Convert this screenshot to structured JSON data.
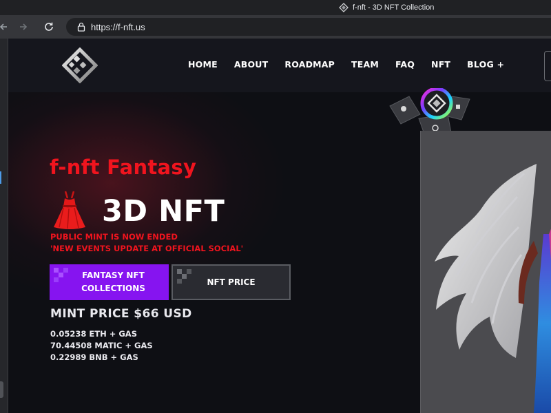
{
  "browser": {
    "tab_title": "f-nft - 3D NFT Collection",
    "url": "https://f-nft.us"
  },
  "site": {
    "nav": [
      {
        "label": "HOME"
      },
      {
        "label": "ABOUT"
      },
      {
        "label": "ROADMAP"
      },
      {
        "label": "TEAM"
      },
      {
        "label": "FAQ"
      },
      {
        "label": "NFT"
      },
      {
        "label": "BLOG +"
      }
    ]
  },
  "hero": {
    "title": "f-nft Fantasy",
    "subtitle": "3D NFT",
    "notices": [
      "PUBLIC MINT IS NOW ENDED",
      "'NEW EVENTS UPDATE AT OFFICIAL SOCIAL'"
    ],
    "buttons": {
      "collections_line1": "FANTASY NFT",
      "collections_line2": "COLLECTIONS",
      "price": "NFT PRICE"
    },
    "mint_price": "MINT PRICE $66 USD",
    "prices": [
      "0.05238 ETH + GAS",
      "70.44508 MATIC + GAS",
      "0.22989 BNB + GAS"
    ]
  },
  "icons": {
    "lock": "lock-icon",
    "back": "back-arrow-icon",
    "forward": "forward-arrow-icon",
    "reload": "reload-icon",
    "dress": "red-dress-icon",
    "logo": "cube-logo-icon"
  },
  "colors": {
    "accent_red": "#f0141e",
    "accent_purple": "#8614f0",
    "page_bg": "#0e0f14"
  }
}
